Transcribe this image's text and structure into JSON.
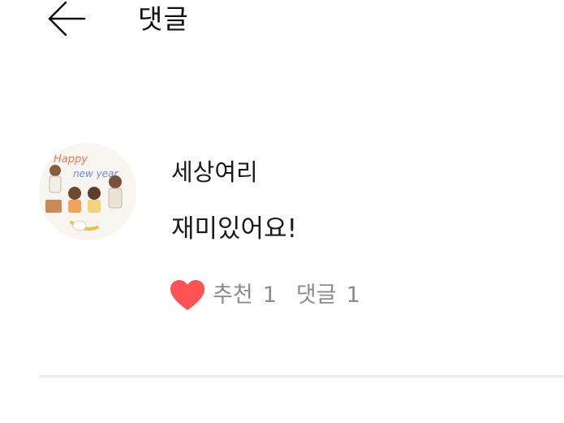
{
  "header": {
    "title": "댓글",
    "back_icon": "arrow-left-icon"
  },
  "comment": {
    "avatar": {
      "caption_line1": "Happy",
      "caption_line2": "new year",
      "icon": "profile-avatar"
    },
    "author": "세상여리",
    "text": "재미있어요!",
    "like": {
      "icon": "heart-icon",
      "icon_color": "#ff5252",
      "label": "추천",
      "count": "1"
    },
    "reply": {
      "label": "댓글",
      "count": "1"
    }
  }
}
